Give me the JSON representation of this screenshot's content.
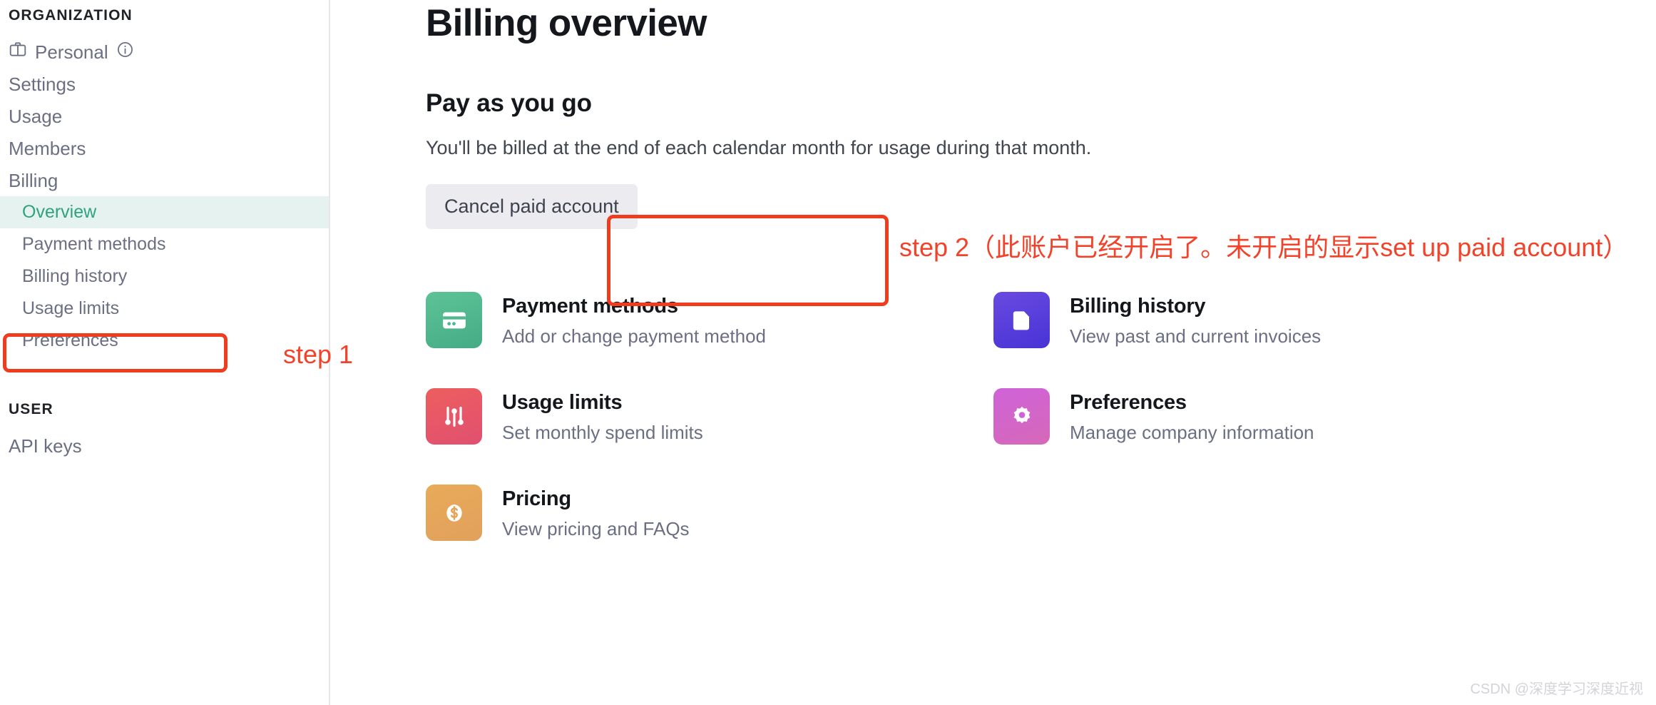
{
  "sidebar": {
    "organization_heading": "ORGANIZATION",
    "user_heading": "USER",
    "org_items": [
      {
        "label": "Personal",
        "icon": "briefcase-icon",
        "trailing_icon": "info-circle-icon"
      },
      {
        "label": "Settings"
      },
      {
        "label": "Usage"
      },
      {
        "label": "Members"
      },
      {
        "label": "Billing"
      }
    ],
    "billing_subitems": [
      {
        "label": "Overview",
        "active": true
      },
      {
        "label": "Payment methods",
        "active": false
      },
      {
        "label": "Billing history",
        "active": false
      },
      {
        "label": "Usage limits",
        "active": false
      },
      {
        "label": "Preferences",
        "active": false
      }
    ],
    "user_items": [
      {
        "label": "API keys"
      }
    ],
    "active_color": "#2fa37c",
    "active_bg": "#e6f2f0"
  },
  "main": {
    "page_title": "Billing overview",
    "section_title": "Pay as you go",
    "section_description": "You'll be billed at the end of each calendar month for usage during that month.",
    "cancel_button_label": "Cancel paid account",
    "cards": [
      {
        "title": "Payment methods",
        "description": "Add or change payment method",
        "icon": "credit-card-icon",
        "color_from": "#5dc396",
        "color_to": "#45ab86"
      },
      {
        "title": "Billing history",
        "description": "View past and current invoices",
        "icon": "document-icon",
        "color_from": "#6a4ae0",
        "color_to": "#4733d6"
      },
      {
        "title": "Usage limits",
        "description": "Set monthly spend limits",
        "icon": "sliders-icon",
        "color_from": "#ed5e5e",
        "color_to": "#e05070"
      },
      {
        "title": "Preferences",
        "description": "Manage company information",
        "icon": "gear-icon",
        "color_from": "#cf63d9",
        "color_to": "#d668b8"
      },
      {
        "title": "Pricing",
        "description": "View pricing and FAQs",
        "icon": "dollar-coin-icon",
        "color_from": "#e8ab58",
        "color_to": "#e2a05d"
      }
    ]
  },
  "annotations": {
    "color": "#f2432a",
    "step1_text": "step 1",
    "step2_text": "step 2（此账户已经开启了。未开启的显示set up paid account）"
  },
  "watermark": "CSDN @深度学习深度近视"
}
